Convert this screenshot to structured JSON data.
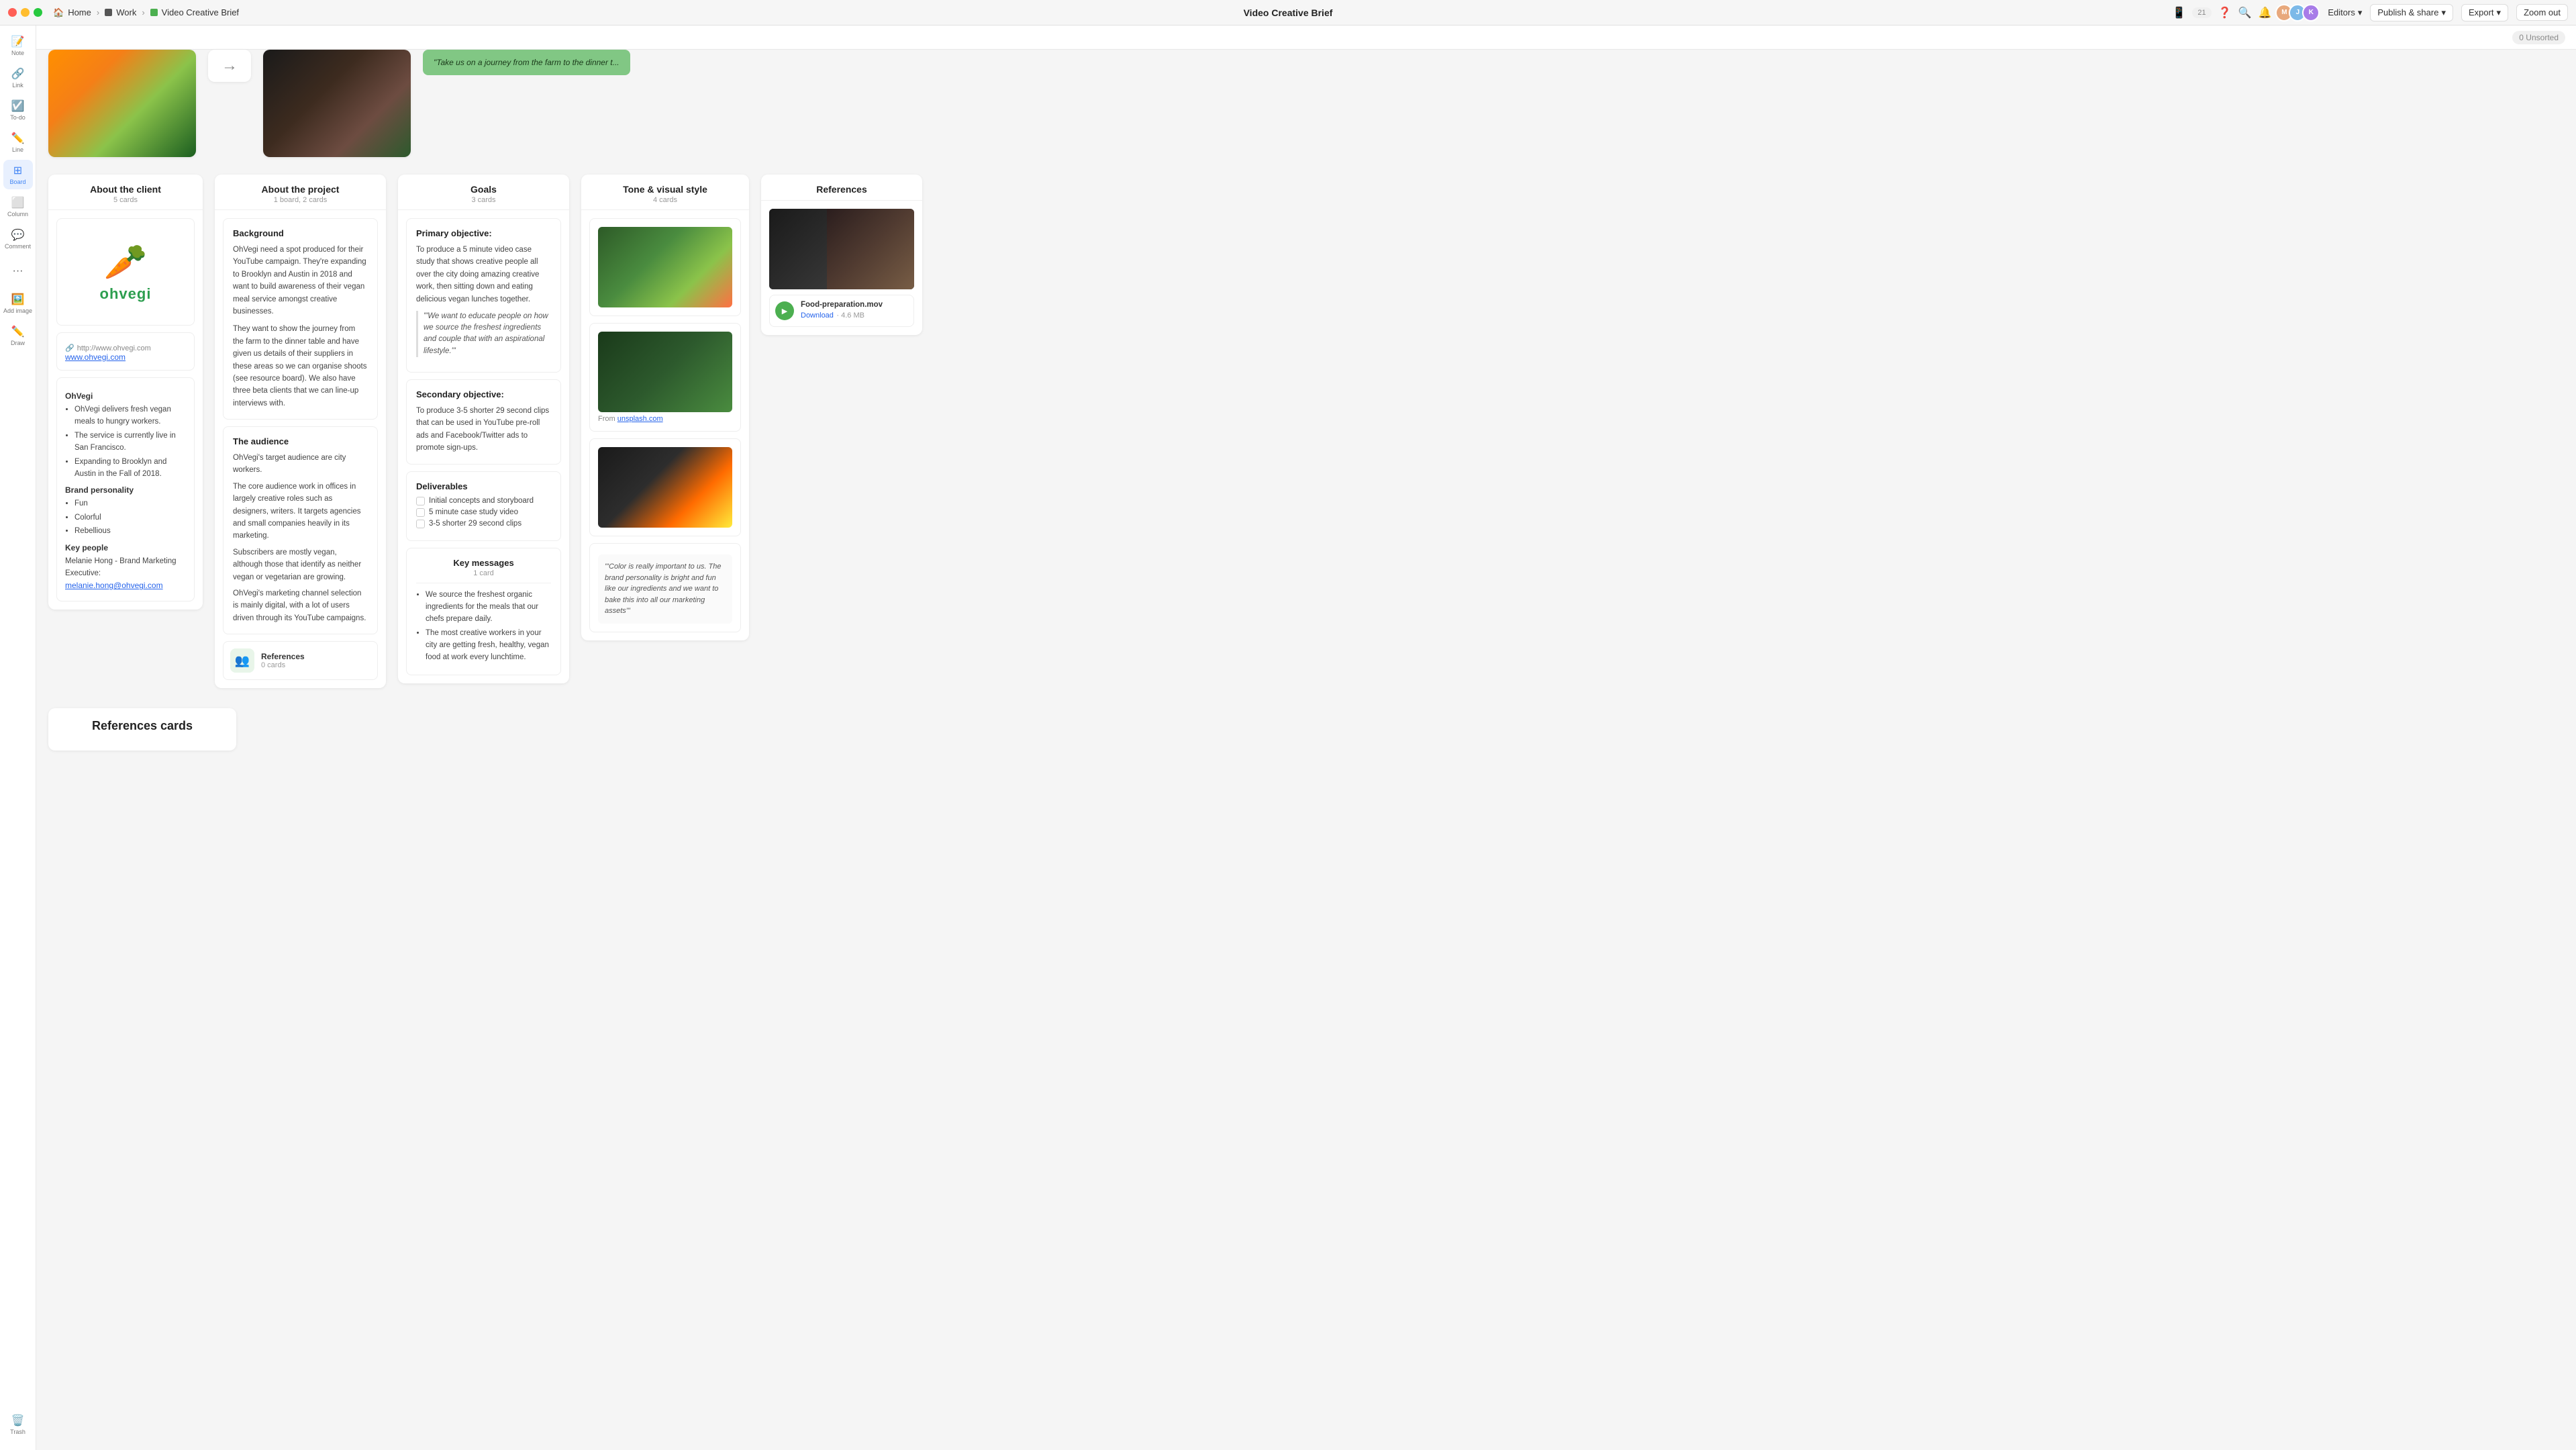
{
  "titlebar": {
    "app_name": "Home",
    "breadcrumb": [
      {
        "label": "Work",
        "type": "dark"
      },
      {
        "label": "Video Creative Brief",
        "type": "green"
      }
    ],
    "title": "Video Creative Brief",
    "editors_label": "Editors",
    "publish_label": "Publish & share",
    "export_label": "Export",
    "zoomout_label": "Zoom out",
    "notifications_count": "21"
  },
  "sidebar": {
    "items": [
      {
        "id": "note",
        "label": "Note",
        "icon": "📝"
      },
      {
        "id": "link",
        "label": "Link",
        "icon": "🔗"
      },
      {
        "id": "todo",
        "label": "To-do",
        "icon": "☑️"
      },
      {
        "id": "line",
        "label": "Line",
        "icon": "✏️"
      },
      {
        "id": "board",
        "label": "Board",
        "icon": "⊞",
        "active": true
      },
      {
        "id": "column",
        "label": "Column",
        "icon": "⬜"
      },
      {
        "id": "comment",
        "label": "Comment",
        "icon": "💬"
      },
      {
        "id": "more",
        "label": "...",
        "icon": "···"
      },
      {
        "id": "add_image",
        "label": "Add image",
        "icon": "🖼️"
      },
      {
        "id": "draw",
        "label": "Draw",
        "icon": "✏️"
      }
    ],
    "trash_label": "Trash"
  },
  "canvas": {
    "unsorted_label": "0 Unsorted"
  },
  "columns": {
    "about_client": {
      "title": "About the client",
      "subtitle": "5 cards",
      "logo_url": "http://www.ohvegi.com",
      "logo_link": "www.ohvegi.com",
      "company_name": "OhVegi",
      "bullets": [
        "OhVegi delivers fresh vegan meals to hungry workers.",
        "The service is currently live in San Francisco.",
        "Expanding to Brooklyn and Austin in the Fall of 2018."
      ],
      "brand_title": "Brand personality",
      "brand_bullets": [
        "Fun",
        "Colorful",
        "Rebellious"
      ],
      "key_people_title": "Key people",
      "key_people_text": "Melanie Hong - Brand Marketing Executive:",
      "key_people_email": "melanie.hong@ohvegi.com"
    },
    "about_project": {
      "title": "About the project",
      "subtitle": "1 board, 2 cards",
      "background_title": "Background",
      "background_text": "OhVegi need a spot produced for their YouTube campaign. They're expanding to Brooklyn and Austin in 2018 and want to build awareness of their vegan meal service amongst creative businesses.",
      "background_text2": "They want to show the journey from the farm to the dinner table and have given us details of their suppliers in these areas so we can organise shoots (see resource board). We also have three beta clients that we can line-up interviews with.",
      "audience_title": "The audience",
      "audience_text1": "OhVegi's target audience are city workers.",
      "audience_text2": "The core audience work in offices in largely creative roles such as designers, writers. It targets agencies and small companies heavily in its marketing.",
      "audience_text3": "Subscribers are mostly vegan, although those that identify as neither vegan or vegetarian are growing.",
      "audience_text4": "OhVegi's marketing channel selection is mainly digital, with a lot of users driven through its YouTube campaigns.",
      "references_name": "References",
      "references_count": "0 cards"
    },
    "goals": {
      "title": "Goals",
      "subtitle": "3 cards",
      "primary_label": "Primary objective:",
      "primary_text": "To produce a 5 minute video case study that shows creative people all over the city doing amazing creative work, then sitting down and eating delicious vegan lunches together.",
      "quote": "\"'We want to educate people on how we source the freshest ingredients and couple that with an aspirational lifestyle.'\"",
      "secondary_label": "Secondary objective:",
      "secondary_text": "To produce 3-5 shorter 29 second clips that can be used in YouTube pre-roll ads and Facebook/Twitter ads to promote sign-ups.",
      "deliverables_label": "Deliverables",
      "deliverables": [
        "Initial concepts and storyboard",
        "5 minute case study video",
        "3-5 shorter 29 second clips"
      ],
      "key_messages_label": "Key messages",
      "key_messages_subtitle": "1 card",
      "key_messages": [
        "We source the freshest organic ingredients for the meals that our chefs prepare daily.",
        "The most creative workers in your city are getting fresh, healthy, vegan food at work every lunchtime."
      ]
    },
    "tone": {
      "title": "Tone & visual style",
      "subtitle": "4 cards",
      "from_label": "From",
      "unsplash_link": "unsplash.com",
      "quote": "\"'Color is really important to us. The brand personality is bright and fun like our ingredients and we want to bake this into all our marketing assets'\""
    },
    "references": {
      "title": "References",
      "video_file": "Food-preparation.mov",
      "video_download": "Download",
      "video_size": "4.6 MB"
    }
  },
  "unsorted": {
    "quote_banner": "\"Take us on a journey from the farm to the dinner t...",
    "references_cards_label": "References cards"
  }
}
